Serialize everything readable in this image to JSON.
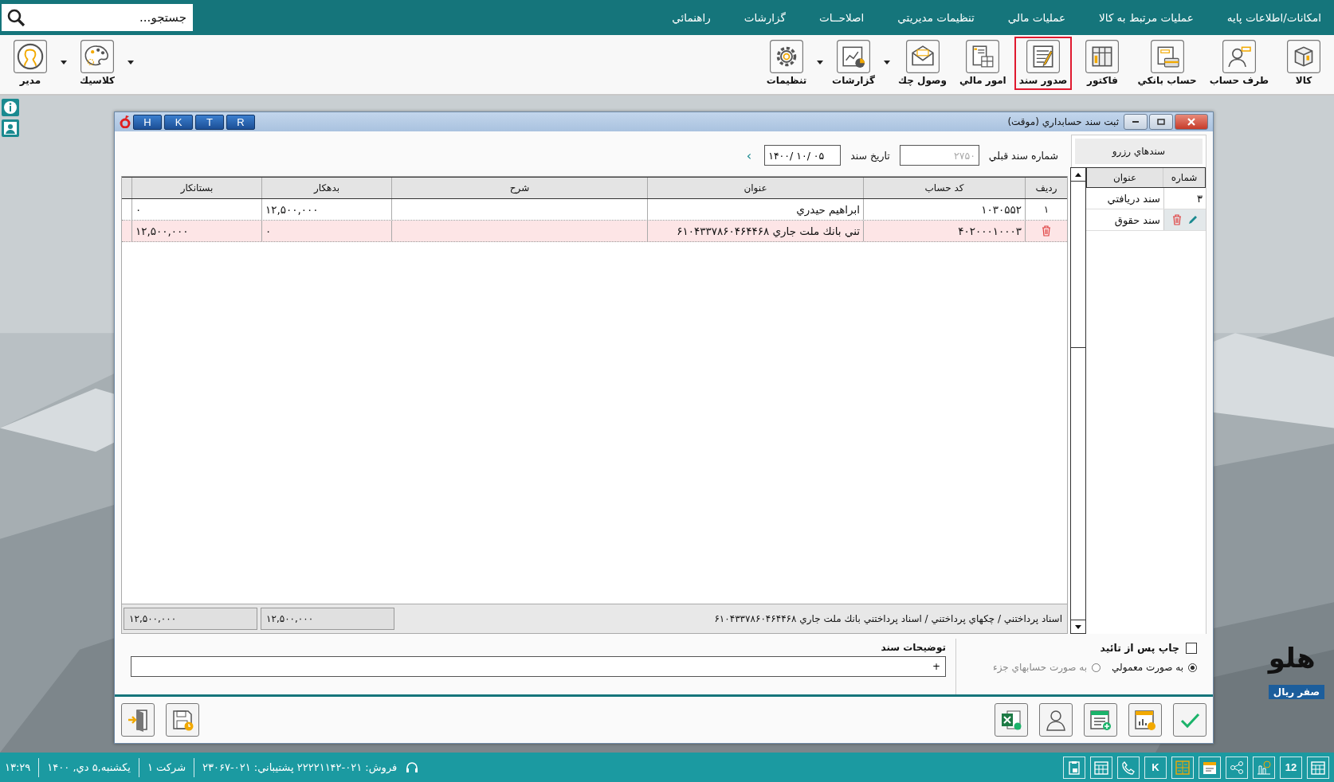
{
  "menu": [
    {
      "label": "امکانات/اطلاعات پايه"
    },
    {
      "label": "عمليات مرتبط به كالا"
    },
    {
      "label": "عمليات مالي"
    },
    {
      "label": "تنظيمات مديريتي"
    },
    {
      "label": "اصلاحــات"
    },
    {
      "label": "گزارشات"
    },
    {
      "label": "راهنمائي"
    }
  ],
  "search": {
    "placeholder": "جستجو..."
  },
  "toolbar": [
    {
      "kind": "button",
      "label": "كالا",
      "selected": false
    },
    {
      "kind": "button",
      "label": "طرف حساب",
      "selected": false
    },
    {
      "kind": "button",
      "label": "حساب بانكي",
      "selected": false
    },
    {
      "kind": "button",
      "label": "فاكتور",
      "selected": false
    },
    {
      "kind": "button",
      "label": "صدور سند",
      "selected": true
    },
    {
      "kind": "button",
      "label": "امور مالي",
      "selected": false
    },
    {
      "kind": "button",
      "label": "وصول چك",
      "selected": false
    },
    {
      "kind": "arrow"
    },
    {
      "kind": "button",
      "label": "گزارشات",
      "selected": false
    },
    {
      "kind": "arrow"
    },
    {
      "kind": "button",
      "label": "تنظيمات",
      "selected": false
    }
  ],
  "toolbar_left": [
    {
      "kind": "arrow"
    },
    {
      "kind": "button",
      "label": "كلاسيك",
      "selected": false
    },
    {
      "kind": "arrow"
    },
    {
      "kind": "button",
      "label": "مدير",
      "selected": false
    }
  ],
  "window": {
    "title": "ثبت سند حسابداري (موقت)",
    "keys": [
      "R",
      "T",
      "K",
      "H"
    ]
  },
  "form": {
    "prev_label": "شماره سند قبلي",
    "prev_value": "۲۷۵۰",
    "prev_disabled": true,
    "date_label": "تاريخ سند",
    "date_value": "۱۴۰۰/ ۱۰/ ۰۵",
    "next": "›"
  },
  "reserved": {
    "button": "سندهاي رزرو",
    "columns": [
      "شماره",
      "عنوان"
    ],
    "rows": [
      {
        "kind": "plain",
        "number": "۳",
        "title": "سند دريافتي"
      },
      {
        "kind": "actions",
        "title": "سند حقوق"
      }
    ]
  },
  "table": {
    "columns": [
      "رديف",
      "كد حساب",
      "عنوان",
      "شرح",
      "بدهكار",
      "بستانكار"
    ],
    "rows": [
      {
        "kind": "plain",
        "row": "۱",
        "code": "۱۰۳۰۵۵۲",
        "title": "ابراهيم حيدري",
        "desc": "",
        "debit": "۱۲,۵۰۰,۰۰۰",
        "credit": "۰",
        "selected": false
      },
      {
        "kind": "delete",
        "code": "۴۰۲۰۰۰۱۰۰۰۳",
        "title": "تني بانك ملت جاري ۶۱۰۴۳۳۷۸۶۰۴۶۴۴۶۸",
        "desc": "",
        "debit": "۰",
        "credit": "۱۲,۵۰۰,۰۰۰",
        "selected": true
      }
    ],
    "path": "اسناد پرداختني / چكهاي پرداختني / اسناد پرداختني بانك ملت جاري ۶۱۰۴۳۳۷۸۶۰۴۶۴۴۶۸",
    "total_debit": "۱۲,۵۰۰,۰۰۰",
    "total_credit": "۱۲,۵۰۰,۰۰۰"
  },
  "options": {
    "print_label": "چاپ پس از تائيد",
    "print_checked": false,
    "radios": [
      {
        "label": "به صورت معمولي",
        "selected": true
      },
      {
        "label": "به صورت حسابهاي جزء",
        "selected": false
      }
    ],
    "notes_label": "توضيحات سند",
    "notes_value": "+"
  },
  "desktop": {
    "logo": "هلو",
    "balance": "صفر ريال"
  },
  "status": {
    "icons": [
      {
        "kind": "grid"
      },
      {
        "kind": "calendar",
        "label": "12"
      },
      {
        "kind": "clock"
      },
      {
        "kind": "share"
      },
      {
        "kind": "note"
      },
      {
        "kind": "calc"
      },
      {
        "kind": "letter",
        "label": "K"
      },
      {
        "kind": "phone"
      },
      {
        "kind": "grid"
      },
      {
        "kind": "clipboard"
      }
    ],
    "contact": "فروش: ۰۲۱-۲۲۲۲۱۱۴۲ پشتيباني: ۰۲۱-۲۳۰۶۷",
    "company": "شرکت ۱",
    "date": "يكشنبه,۵ دي, ۱۴۰۰",
    "time": "۱۳:۲۹"
  }
}
